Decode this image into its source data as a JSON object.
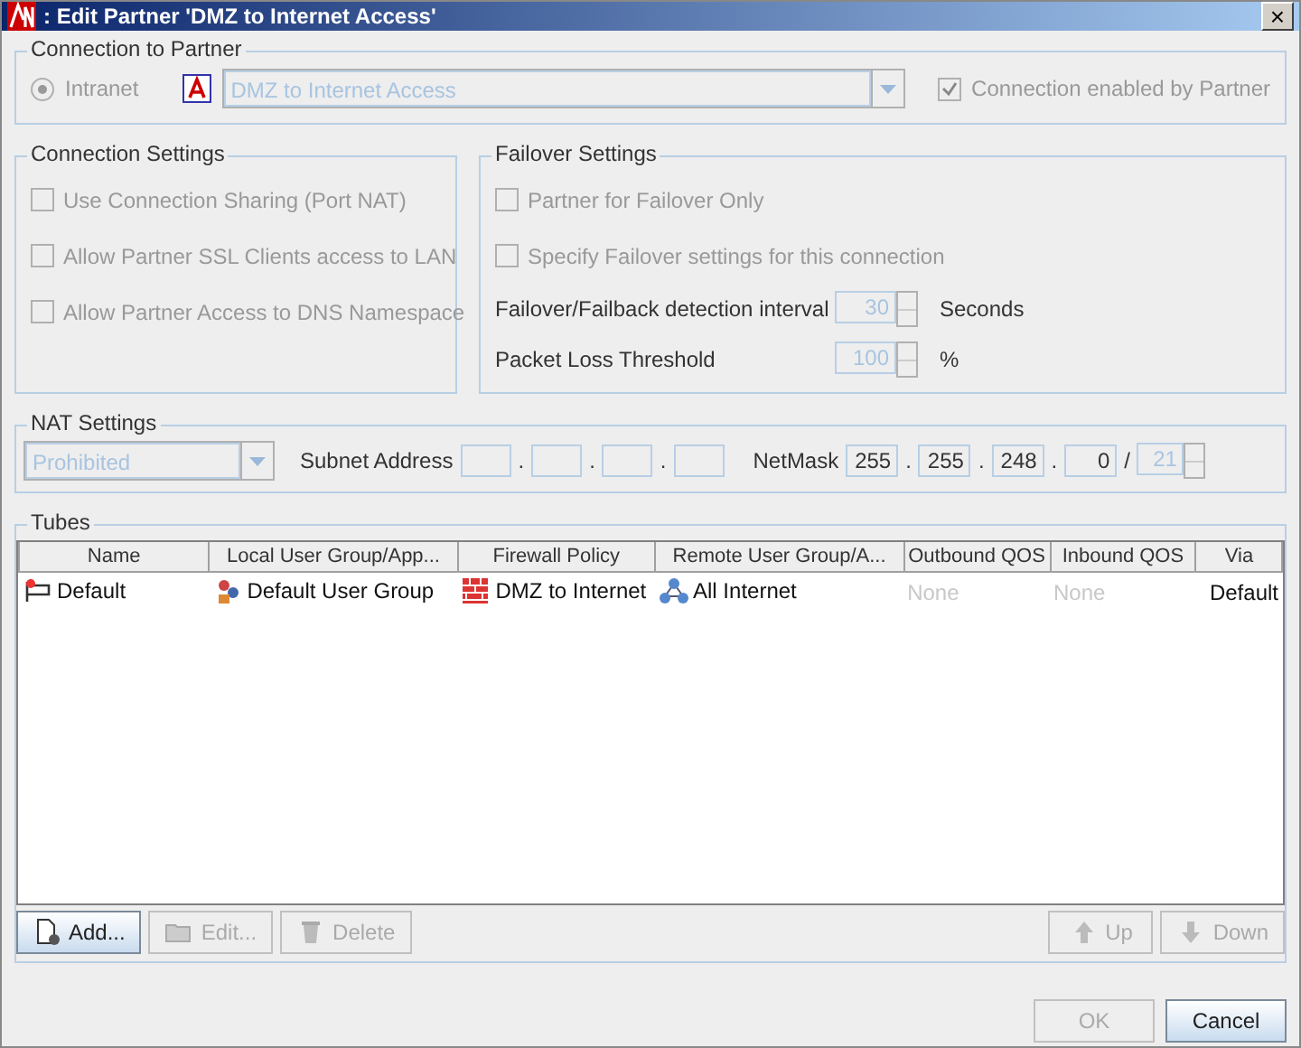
{
  "window": {
    "title": ": Edit Partner 'DMZ to Internet Access'",
    "close": "×"
  },
  "connection_to_partner": {
    "legend": "Connection to Partner",
    "type": {
      "label": "Intranet",
      "selected": true,
      "disabled": true
    },
    "partner": {
      "value": "DMZ to Internet Access",
      "disabled": true
    },
    "enabled": {
      "label": "Connection enabled by Partner",
      "checked": true,
      "disabled": true
    }
  },
  "connection_settings": {
    "legend": "Connection Settings",
    "options": [
      {
        "label": "Use Connection Sharing (Port NAT)",
        "checked": false,
        "disabled": true
      },
      {
        "label": "Allow Partner SSL Clients access to LAN",
        "checked": false,
        "disabled": true
      },
      {
        "label": "Allow Partner Access to DNS Namespace",
        "checked": false,
        "disabled": true
      }
    ]
  },
  "failover_settings": {
    "legend": "Failover Settings",
    "options": [
      {
        "label": "Partner for Failover Only",
        "checked": false,
        "disabled": true
      },
      {
        "label": "Specify Failover settings for this connection",
        "checked": false,
        "disabled": true
      }
    ],
    "spinners": [
      {
        "label": "Failover/Failback detection interval",
        "value": "30",
        "unit": "Seconds",
        "disabled": true
      },
      {
        "label": "Packet Loss Threshold",
        "value": "100",
        "unit": "%",
        "disabled": true
      }
    ]
  },
  "nat_settings": {
    "legend": "NAT Settings",
    "mode": {
      "value": "Prohibited",
      "disabled": true
    },
    "subnet_label": "Subnet Address",
    "subnet_separators": [
      ".",
      ".",
      "."
    ],
    "netmask_label": "NetMask",
    "netmask": [
      "255",
      "255",
      "248",
      "0"
    ],
    "netmask_separators": [
      ".",
      ".",
      "."
    ],
    "prefix_separator": "/",
    "prefix": {
      "value": "21",
      "disabled": true
    }
  },
  "tubes": {
    "legend": "Tubes",
    "columns": [
      "Name",
      "Local User Group/App...",
      "Firewall Policy",
      "Remote User Group/A...",
      "Outbound QOS",
      "Inbound QOS",
      "Via"
    ],
    "rows": [
      {
        "selected": false,
        "cells": [
          {
            "text": "Default",
            "kind": "tube",
            "disabled": false
          },
          {
            "text": "Default User Group",
            "kind": "users",
            "disabled": false
          },
          {
            "text": "DMZ to Internet",
            "kind": "firewall",
            "disabled": false
          },
          {
            "text": "All Internet",
            "kind": "network",
            "disabled": false
          },
          {
            "text": "None",
            "kind": "plain",
            "disabled": true
          },
          {
            "text": "None",
            "kind": "plain",
            "disabled": true
          },
          {
            "text": "Default",
            "kind": "plain",
            "disabled": false
          }
        ]
      }
    ],
    "buttons": [
      {
        "label": "Add...",
        "kind": "add",
        "disabled": false
      },
      {
        "label": "Edit...",
        "kind": "folder",
        "disabled": true
      },
      {
        "label": "Delete",
        "kind": "trash",
        "disabled": true
      },
      {
        "label": "Up",
        "kind": "up",
        "disabled": true
      },
      {
        "label": "Down",
        "kind": "down",
        "disabled": true
      }
    ]
  },
  "footer_buttons": [
    {
      "label": "OK",
      "disabled": true
    },
    {
      "label": "Cancel",
      "disabled": false
    }
  ]
}
